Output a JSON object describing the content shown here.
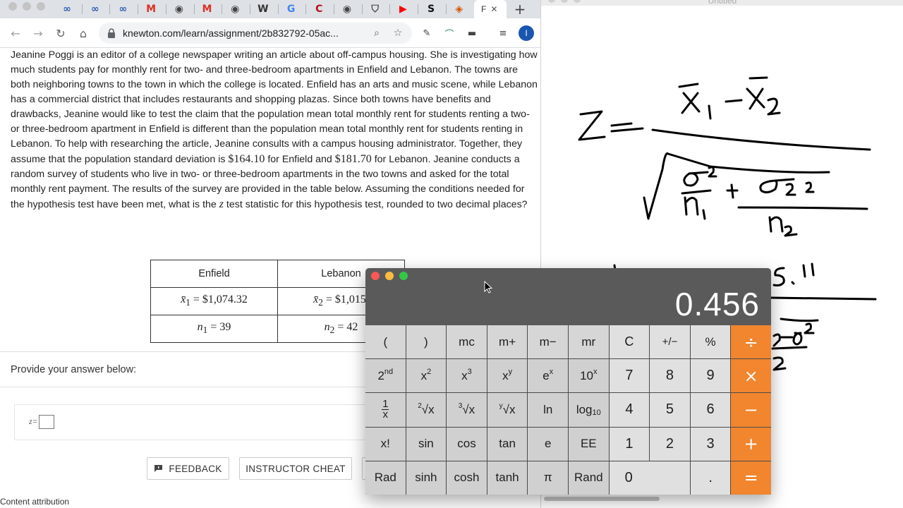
{
  "browser": {
    "tab_favicons": [
      {
        "name": "knewton-tab",
        "glyph": "∞",
        "color": "#2f5fb3"
      },
      {
        "name": "knewton-tab",
        "glyph": "∞",
        "color": "#2f5fb3"
      },
      {
        "name": "knewton-tab",
        "glyph": "∞",
        "color": "#2f5fb3"
      },
      {
        "name": "gmail-tab",
        "glyph": "M",
        "color": "#d93025"
      },
      {
        "name": "globe-tab",
        "glyph": "◉",
        "color": "#444444"
      },
      {
        "name": "gmail-tab",
        "glyph": "M",
        "color": "#d93025"
      },
      {
        "name": "globe-tab",
        "glyph": "◉",
        "color": "#444444"
      },
      {
        "name": "wikipedia-tab",
        "glyph": "W",
        "color": "#333333"
      },
      {
        "name": "google-tab",
        "glyph": "G",
        "color": "#4285f4"
      },
      {
        "name": "c-tab",
        "glyph": "C",
        "color": "#b3121b"
      },
      {
        "name": "globe-tab",
        "glyph": "◉",
        "color": "#444444"
      },
      {
        "name": "shield-tab",
        "glyph": "⛉",
        "color": "#444444"
      },
      {
        "name": "youtube-tab",
        "glyph": "▶",
        "color": "#ff0000"
      },
      {
        "name": "s-tab",
        "glyph": "S",
        "color": "#111111"
      },
      {
        "name": "colorful-tab",
        "glyph": "◈",
        "color": "#d35400"
      }
    ],
    "active_tab_label": "F",
    "active_tab_close": "✕",
    "new_tab_label": "+",
    "url": "knewton.com/learn/assignment/2b832792-05ac...",
    "profile_initial": "I"
  },
  "problem": {
    "text_1": "Jeanine Poggi is an editor of a college newspaper writing an article about off-campus housing. She is investigating how much students pay for monthly rent for two- and three-bedroom apartments in Enfield and Lebanon. The towns are both neighboring towns to the town in which the college is located. Enfield has an arts and music scene, while Lebanon has a commercial district that includes restaurants and shopping plazas. Since both towns have benefits and drawbacks, Jeanine would like to test the claim that the population mean total monthly rent for students renting a two- or three-bedroom apartment in Enfield is different than the population mean total monthly rent for students renting in Lebanon. To help with researching the article, Jeanine consults with a campus housing administrator. Together, they assume that the population standard deviation is ",
    "sd_enfield": "$164.10",
    "text_2": " for Enfield and ",
    "sd_lebanon": "$181.70",
    "text_3": " for Lebanon. Jeanine conducts a random survey of students who live in two- or three-bedroom apartments in the two towns and asked for the total monthly rent payment. The results of the survey are provided in the table below. Assuming the conditions needed for the hypothesis test have been met, what is the ",
    "z_var": "z",
    "text_4": " test statistic for this hypothesis test, rounded to two decimal places?"
  },
  "table": {
    "headers": [
      "Enfield",
      "Lebanon"
    ],
    "mean_row": {
      "enfield_sym": "x̄",
      "enfield_sub": "1",
      "enfield_val": " = $1,074.32",
      "lebanon_sym": "x̄",
      "lebanon_sub": "2",
      "lebanon_val": " = $1,015."
    },
    "n_row": {
      "enfield_sym": "n",
      "enfield_sub": "1",
      "enfield_val": " = 39",
      "lebanon_sym": "n",
      "lebanon_sub": "2",
      "lebanon_val": " = 42"
    }
  },
  "answer": {
    "prompt": "Provide your answer below:",
    "z_label": "z=",
    "z_value": ""
  },
  "buttons": {
    "feedback": "FEEDBACK",
    "instructor_cheat": "INSTRUCTOR CHEAT"
  },
  "status_bar": "Content attribution",
  "whiteboard": {
    "title": "Untitled"
  },
  "calculator": {
    "display": "0.456",
    "colors": {
      "operator": "#f1862e",
      "light_red": "#fc5753",
      "light_yellow": "#fdbc40",
      "light_green": "#33c748"
    },
    "row1": [
      "(",
      ")",
      "mc",
      "m+",
      "m−",
      "mr",
      "C",
      "+/−",
      "%",
      "÷"
    ],
    "row2_sci": [
      "2nd",
      "x²",
      "x³",
      "xʸ",
      "eˣ",
      "10ˣ"
    ],
    "row2_num": [
      "7",
      "8",
      "9",
      "×"
    ],
    "row3_sci": [
      "1/x",
      "²√x",
      "³√x",
      "ʸ√x",
      "ln",
      "log₁₀"
    ],
    "row3_num": [
      "4",
      "5",
      "6",
      "−"
    ],
    "row4_sci": [
      "x!",
      "sin",
      "cos",
      "tan",
      "e",
      "EE"
    ],
    "row4_num": [
      "1",
      "2",
      "3",
      "+"
    ],
    "row5_sci": [
      "Rad",
      "sinh",
      "cosh",
      "tanh",
      "π",
      "Rand"
    ],
    "row5_num": [
      "0",
      ".",
      "="
    ]
  }
}
